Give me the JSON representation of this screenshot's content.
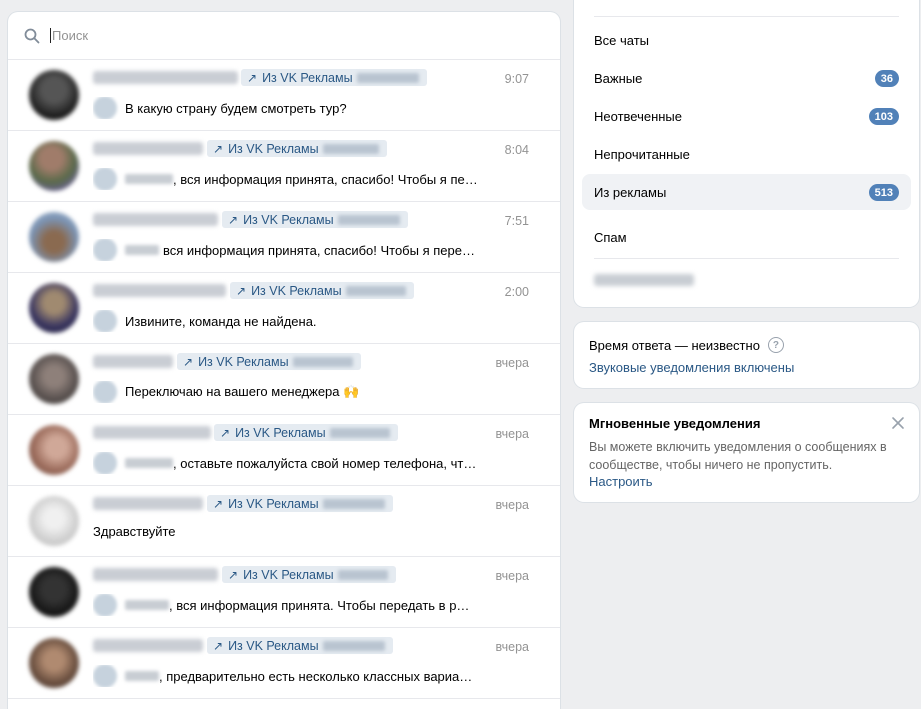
{
  "search": {
    "placeholder": "Поиск"
  },
  "conversations": [
    {
      "tag": "Из VK Рекламы",
      "time": "9:07",
      "preview": "В какую страну будем смотреть тур?",
      "avatar_color": "#2b2b2b"
    },
    {
      "tag": "Из VK Рекламы",
      "time": "8:04",
      "preview": ", вся информация принята, спасибо! Чтобы я пе…",
      "avatar_color": "#7c6a5a"
    },
    {
      "tag": "Из VK Рекламы",
      "time": "7:51",
      "preview": "вся информация принята, спасибо! Чтобы я пере…",
      "avatar_color": "#7a8fa6"
    },
    {
      "tag": "Из VK Рекламы",
      "time": "2:00",
      "preview": "Извините, команда не найдена.",
      "avatar_color": "#3c3a55"
    },
    {
      "tag": "Из VK Рекламы",
      "time": "вчера",
      "preview": "Переключаю на вашего менеджера 🙌",
      "avatar_color": "#6d6461"
    },
    {
      "tag": "Из VK Рекламы",
      "time": "вчера",
      "preview": ", оставьте пожалуйста свой номер телефона, чт…",
      "avatar_color": "#a77a6c"
    },
    {
      "tag": "Из VK Рекламы",
      "time": "вчера",
      "preview": "Здравствуйте",
      "avatar_color": "#d6d6d6"
    },
    {
      "tag": "Из VK Рекламы",
      "time": "вчера",
      "preview": ", вся информация принята. Чтобы передать в р…",
      "avatar_color": "#1e1e1e"
    },
    {
      "tag": "Из VK Рекламы",
      "time": "вчера",
      "preview": ", предварительно есть несколько классных вариа…",
      "avatar_color": "#6b5547"
    }
  ],
  "folders": [
    {
      "label": "Все чаты",
      "count": null
    },
    {
      "label": "Важные",
      "count": "36"
    },
    {
      "label": "Неотвеченные",
      "count": "103"
    },
    {
      "label": "Непрочитанные",
      "count": null
    },
    {
      "label": "Из рекламы",
      "count": "513"
    },
    {
      "label": "Спам",
      "count": null
    }
  ],
  "response": {
    "time_text": "Время ответа — неизвестно",
    "help_icon": "?",
    "sound_link": "Звуковые уведомления включены"
  },
  "instant": {
    "title": "Мгновенные уведомления",
    "description": "Вы можете включить уведомления о сообщениях в сообществе, чтобы ничего не пропустить.",
    "setup_link": "Настроить"
  },
  "colors": {
    "link": "#2a5885",
    "badge": "#5181b8",
    "background": "#edeef0"
  }
}
